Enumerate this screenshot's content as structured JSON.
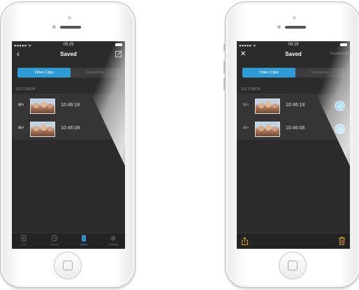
{
  "left_screen": {
    "status": {
      "signal": "●●●●● ᯤ",
      "time": "09:29"
    },
    "nav": {
      "title": "Saved"
    },
    "segments": [
      {
        "label": "Video Clips"
      },
      {
        "label": "Snapshots"
      }
    ],
    "date": "2017/08/24",
    "clips": [
      {
        "time": "10:46:18"
      },
      {
        "time": "10:46:08"
      }
    ],
    "tabs": [
      {
        "label": "Live"
      },
      {
        "label": "History"
      },
      {
        "label": "Album"
      },
      {
        "label": "Settings"
      }
    ]
  },
  "right_screen": {
    "status": {
      "signal": "●●●●● ᯤ",
      "time": "09:29"
    },
    "nav": {
      "title": "Saved",
      "deselect_label": "Deselect All"
    },
    "segments": [
      {
        "label": "Video Clips"
      },
      {
        "label": "Snapshots"
      }
    ],
    "date": "2017/08/24",
    "clips": [
      {
        "time": "10:46:18",
        "selected": true
      },
      {
        "time": "10:46:08",
        "selected": true
      }
    ]
  },
  "colors": {
    "accent": "#2f9bd6",
    "screen_bg": "#2b2b2b",
    "toolbar_icon": "#e8a83a"
  },
  "icons": [
    "back-icon",
    "edit-icon",
    "close-icon",
    "video-camera-icon",
    "checkmark-icon",
    "live-icon",
    "history-icon",
    "album-icon",
    "settings-icon",
    "share-icon",
    "trash-icon"
  ]
}
